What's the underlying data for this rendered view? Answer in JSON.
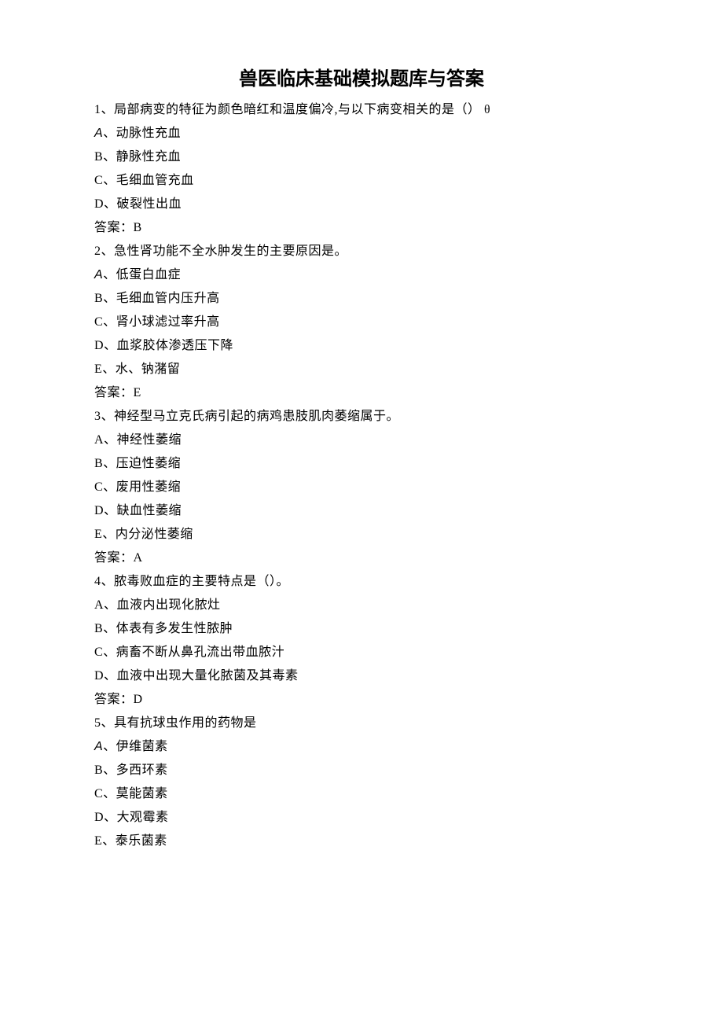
{
  "title": "兽医临床基础模拟题库与答案",
  "questions": [
    {
      "stem": "1、局部病变的特征为颜色暗红和温度偏冷,与以下病变相关的是（） θ",
      "options": [
        "A、动脉性充血",
        "B、静脉性充血",
        "C、毛细血管充血",
        "D、破裂性出血"
      ],
      "a_sans": true,
      "answer": "答案：B"
    },
    {
      "stem": "2、急性肾功能不全水肿发生的主要原因是。",
      "options": [
        "A、低蛋白血症",
        "B、毛细血管内压升高",
        "C、肾小球滤过率升高",
        "D、血浆胶体渗透压下降",
        "E、水、钠潴留"
      ],
      "a_sans": true,
      "answer": "答案：E"
    },
    {
      "stem": "3、神经型马立克氏病引起的病鸡患肢肌肉萎缩属于。",
      "options": [
        "A、神经性萎缩",
        "B、压迫性萎缩",
        "C、废用性萎缩",
        "D、缺血性萎缩",
        "E、内分泌性萎缩"
      ],
      "a_sans": false,
      "answer": "答案：A"
    },
    {
      "stem": "4、脓毒败血症的主要特点是（）。",
      "options": [
        "A、血液内出现化脓灶",
        "B、体表有多发生性脓肿",
        "C、病畜不断从鼻孔流出带血脓汁",
        "D、血液中出现大量化脓菌及其毒素"
      ],
      "a_sans": false,
      "answer": "答案：D"
    },
    {
      "stem": "5、具有抗球虫作用的药物是",
      "options": [
        "A、伊维菌素",
        "B、多西环素",
        "C、莫能菌素",
        "D、大观霉素",
        "E、泰乐菌素"
      ],
      "a_sans": true,
      "answer": ""
    }
  ]
}
